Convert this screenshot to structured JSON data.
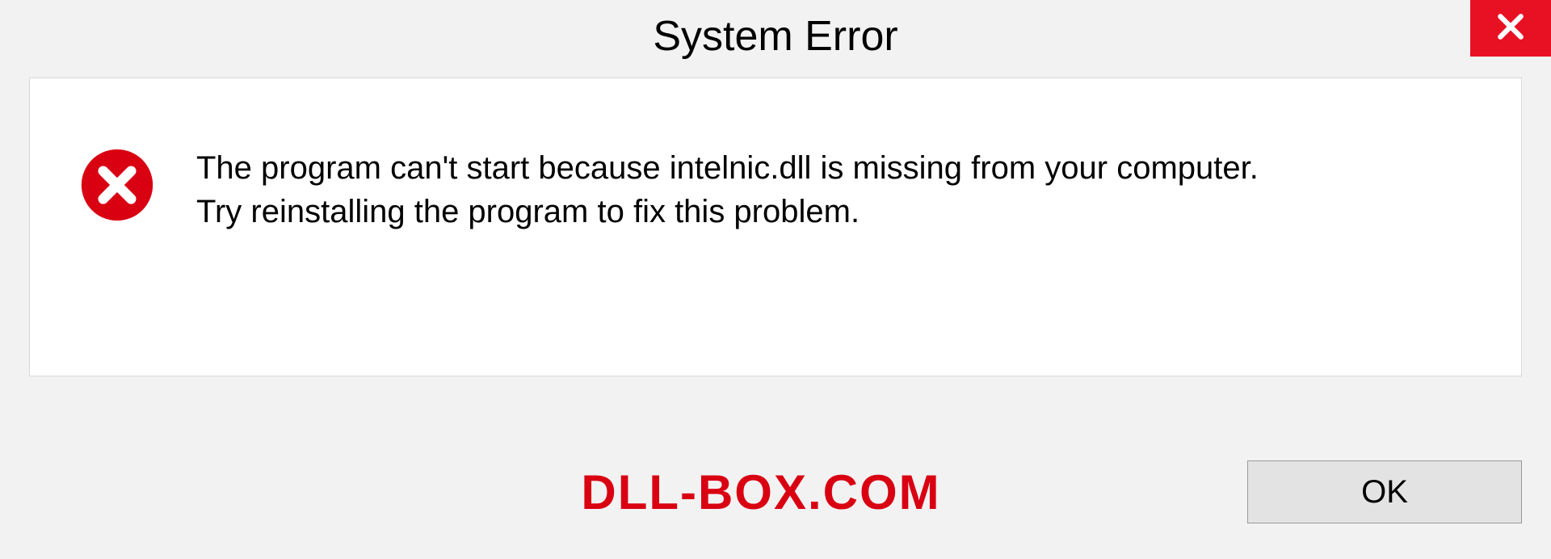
{
  "dialog": {
    "title": "System Error",
    "message_line1": "The program can't start because intelnic.dll is missing from your computer.",
    "message_line2": "Try reinstalling the program to fix this problem.",
    "ok_label": "OK"
  },
  "brand": {
    "text": "DLL-BOX.COM",
    "color": "#d90012"
  },
  "close_button": {
    "bg": "#e81123"
  }
}
